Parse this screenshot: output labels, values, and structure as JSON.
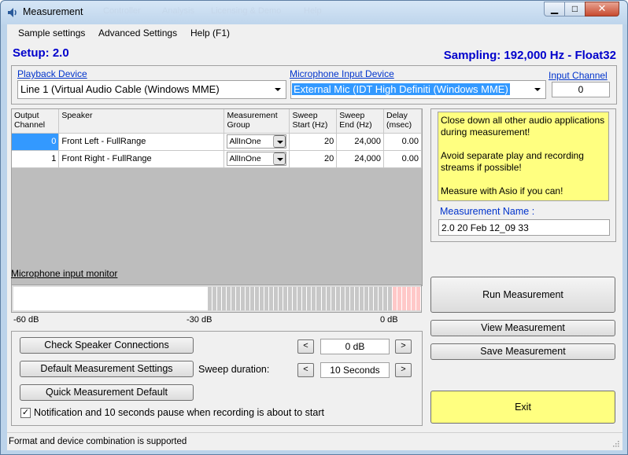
{
  "window": {
    "title": "Measurement",
    "ghost_menu": [
      "Controller",
      "Analysis",
      "Licensing & Demo",
      "Help"
    ]
  },
  "menu": {
    "items": [
      "Sample settings",
      "Advanced Settings",
      "Help (F1)"
    ]
  },
  "header": {
    "setup": "Setup: 2.0",
    "sampling": "Sampling: 192,000 Hz - Float32"
  },
  "devices": {
    "playback_label": "Playback Device",
    "playback_value": "Line 1 (Virtual Audio Cable (Windows MME)",
    "mic_label": "Microphone Input Device",
    "mic_value": "External Mic (IDT High Definiti (Windows MME)",
    "input_channel_label": "Input Channel",
    "input_channel_value": "0"
  },
  "grid": {
    "headers": [
      [
        "Output",
        "Channel"
      ],
      [
        "Speaker",
        ""
      ],
      [
        "Measurement",
        "Group"
      ],
      [
        "Sweep",
        "Start (Hz)"
      ],
      [
        "Sweep",
        "End (Hz)"
      ],
      [
        "Delay",
        "(msec)"
      ]
    ],
    "rows": [
      {
        "channel": "0",
        "speaker": "Front Left - FullRange",
        "group": "AllInOne",
        "start": "20",
        "end": "24,000",
        "delay": "0.00"
      },
      {
        "channel": "1",
        "speaker": "Front Right - FullRange",
        "group": "AllInOne",
        "start": "20",
        "end": "24,000",
        "delay": "0.00"
      }
    ]
  },
  "notes": {
    "lines": [
      "Close down all other audio applications during measurement!",
      "Avoid separate play and recording streams if possible!",
      "Measure with Asio if you can!"
    ],
    "measurement_name_label": "Measurement Name :",
    "measurement_name_value": "2.0 20 Feb 12_09 33"
  },
  "monitor": {
    "label": "Microphone input monitor",
    "scale": [
      "-60 dB",
      "-30 dB",
      "0 dB"
    ],
    "level_fraction": 0.0,
    "colors": {
      "low": "#ffffff",
      "mid": "#c8c8c8",
      "high": "#ffc8c8"
    }
  },
  "controls": {
    "check_speaker": "Check Speaker Connections",
    "default_settings": "Default Measurement Settings",
    "quick_default": "Quick Measurement Default",
    "level_value": "0 dB",
    "sweep_label": "Sweep duration:",
    "sweep_value": "10 Seconds",
    "dec": "<",
    "inc": ">",
    "notify_checked": true,
    "notify_label": "Notification and 10 seconds pause when recording is about to start"
  },
  "actions": {
    "run": "Run Measurement",
    "view": "View Measurement",
    "save": "Save Measurement",
    "exit": "Exit",
    "exit_color": "#ffff80"
  },
  "status": {
    "text": "Format and device combination is supported"
  }
}
